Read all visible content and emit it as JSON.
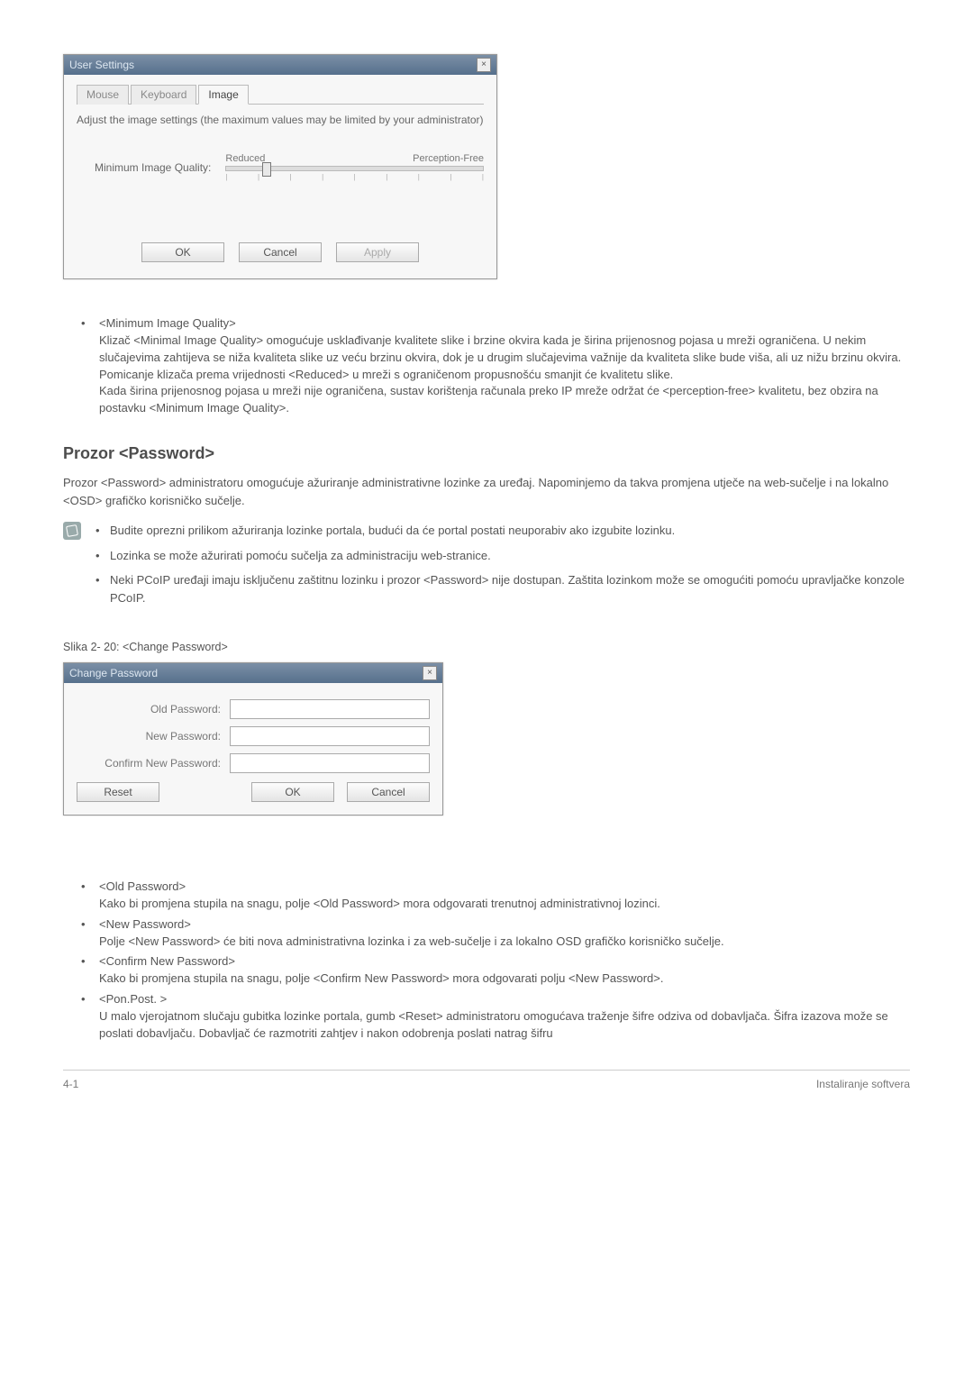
{
  "user_settings_dialog": {
    "title": "User Settings",
    "close_glyph": "×",
    "tabs": {
      "mouse": "Mouse",
      "keyboard": "Keyboard",
      "image": "Image"
    },
    "description": "Adjust the image settings (the maximum values may be limited by your administrator)",
    "slider_label": "Minimum Image Quality:",
    "slider_left": "Reduced",
    "slider_right": "Perception-Free",
    "buttons": {
      "ok": "OK",
      "cancel": "Cancel",
      "apply": "Apply"
    }
  },
  "miq": {
    "term": "<Minimum Image Quality>",
    "p1": "Klizač <Minimal Image Quality> omogućuje usklađivanje kvalitete slike i brzine okvira kada je širina prijenosnog pojasa u mreži ograničena. U nekim slučajevima zahtijeva se niža kvaliteta slike uz veću brzinu okvira, dok je u drugim slučajevima važnije da kvaliteta slike bude viša, ali uz nižu brzinu okvira.",
    "p2": "Pomicanje klizača prema vrijednosti <Reduced> u mreži s ograničenom propusnošću smanjit će kvalitetu slike.",
    "p3": "Kada širina prijenosnog pojasa u mreži nije ograničena, sustav korištenja računala preko IP mreže održat će <perception-free> kvalitetu, bez obzira na postavku <Minimum Image Quality>."
  },
  "password_section": {
    "heading": "Prozor <Password>",
    "intro": "Prozor <Password> administratoru omogućuje ažuriranje administrativne lozinke za uređaj. Napominjemo da takva promjena utječe na web-sučelje i na lokalno <OSD> grafičko korisničko sučelje.",
    "notes": [
      "Budite oprezni prilikom ažuriranja lozinke portala, budući da će portal postati neuporabiv ako izgubite lozinku.",
      "Lozinka se može ažurirati pomoću sučelja za administraciju web-stranice.",
      "Neki PCoIP uređaji imaju isključenu zaštitnu lozinku i prozor <Password> nije dostupan. Zaštita lozinkom može se omogućiti pomoću upravljačke konzole PCoIP."
    ]
  },
  "figure_caption": "Slika 2- 20: <Change Password>",
  "change_password_dialog": {
    "title": "Change Password",
    "close_glyph": "×",
    "labels": {
      "old": "Old Password:",
      "new": "New Password:",
      "confirm": "Confirm New Password:"
    },
    "buttons": {
      "reset": "Reset",
      "ok": "OK",
      "cancel": "Cancel"
    }
  },
  "fields": [
    {
      "term": "<Old Password>",
      "def": "Kako bi promjena stupila na snagu, polje <Old Password> mora odgovarati trenutnoj administrativnoj lozinci."
    },
    {
      "term": "<New Password>",
      "def": "Polje <New Password> će biti nova administrativna lozinka i za web-sučelje i za lokalno OSD grafičko korisničko sučelje."
    },
    {
      "term": "<Confirm New Password>",
      "def": "Kako bi promjena stupila na snagu, polje <Confirm New Password> mora odgovarati polju <New Password>."
    },
    {
      "term": "<Pon.Post. >",
      "def": "U malo vjerojatnom slučaju gubitka lozinke portala, gumb <Reset> administratoru omogućava traženje šifre odziva od dobavljača. Šifra izazova može se poslati dobavljaču. Dobavljač će razmotriti zahtjev i nakon odobrenja poslati natrag šifru"
    }
  ],
  "footer": {
    "left": "4-1",
    "right": "Instaliranje softvera"
  }
}
